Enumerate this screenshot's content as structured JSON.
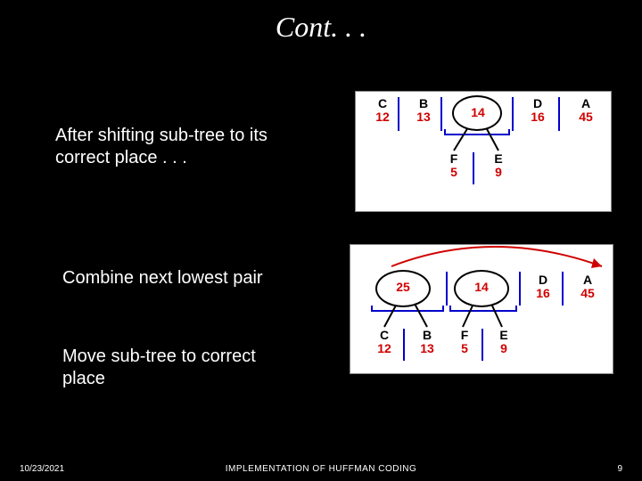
{
  "title": "Cont. . .",
  "text1": "After shifting sub-tree to its correct place . . .",
  "text2": "Combine next lowest pair",
  "text3": "Move sub-tree to correct place",
  "footer": {
    "date": "10/23/2021",
    "center": "IMPLEMENTATION OF  HUFFMAN CODING",
    "page": "9"
  },
  "dia1": {
    "top": [
      {
        "label": "C",
        "value": "12"
      },
      {
        "label": "B",
        "value": "13"
      },
      {
        "label": "",
        "value": "14",
        "ellipse": true
      },
      {
        "label": "D",
        "value": "16"
      },
      {
        "label": "A",
        "value": "45"
      }
    ],
    "children": [
      {
        "label": "F",
        "value": "5"
      },
      {
        "label": "E",
        "value": "9"
      }
    ]
  },
  "dia2": {
    "top": [
      {
        "label": "",
        "value": "25",
        "ellipse": true
      },
      {
        "label": "",
        "value": "14",
        "ellipse": true
      },
      {
        "label": "D",
        "value": "16"
      },
      {
        "label": "A",
        "value": "45"
      }
    ],
    "children25": [
      {
        "label": "C",
        "value": "12"
      },
      {
        "label": "B",
        "value": "13"
      }
    ],
    "children14": [
      {
        "label": "F",
        "value": "5"
      },
      {
        "label": "E",
        "value": "9"
      }
    ]
  },
  "chart_data": [
    {
      "type": "table",
      "title": "Huffman priority list after shifting sub-tree",
      "nodes": [
        {
          "symbol": "C",
          "freq": 12
        },
        {
          "symbol": "B",
          "freq": 13
        },
        {
          "symbol": "(F+E)",
          "freq": 14,
          "children": [
            {
              "symbol": "F",
              "freq": 5
            },
            {
              "symbol": "E",
              "freq": 9
            }
          ]
        },
        {
          "symbol": "D",
          "freq": 16
        },
        {
          "symbol": "A",
          "freq": 45
        }
      ]
    },
    {
      "type": "table",
      "title": "After combining next lowest pair and moving sub-tree",
      "nodes": [
        {
          "symbol": "(C+B)",
          "freq": 25,
          "children": [
            {
              "symbol": "C",
              "freq": 12
            },
            {
              "symbol": "B",
              "freq": 13
            }
          ]
        },
        {
          "symbol": "(F+E)",
          "freq": 14,
          "children": [
            {
              "symbol": "F",
              "freq": 5
            },
            {
              "symbol": "E",
              "freq": 9
            }
          ]
        },
        {
          "symbol": "D",
          "freq": 16
        },
        {
          "symbol": "A",
          "freq": 45
        }
      ]
    }
  ]
}
